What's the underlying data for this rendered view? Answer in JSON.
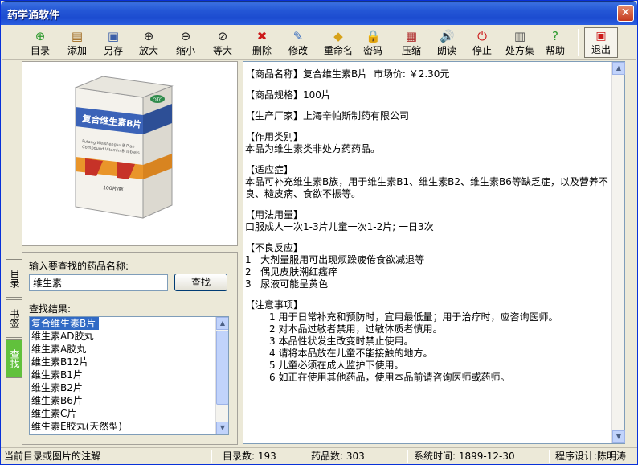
{
  "window": {
    "title": "药学通软件"
  },
  "toolbar": [
    {
      "label": "目录",
      "icon": "plus-circle-icon",
      "glyph": "⊕",
      "color": "#2e9a2e"
    },
    {
      "label": "添加",
      "icon": "add-folder-icon",
      "glyph": "▤",
      "color": "#a06a20"
    },
    {
      "label": "另存",
      "icon": "save-disk-icon",
      "glyph": "▣",
      "color": "#3b5fa8"
    },
    {
      "label": "放大",
      "icon": "zoom-in-icon",
      "glyph": "⊕",
      "color": "#222222"
    },
    {
      "label": "缩小",
      "icon": "zoom-out-icon",
      "glyph": "⊖",
      "color": "#222222"
    },
    {
      "label": "等大",
      "icon": "zoom-actual-icon",
      "glyph": "⊘",
      "color": "#222222"
    },
    {
      "label": "删除",
      "icon": "delete-icon",
      "glyph": "✖",
      "color": "#cc1a1a"
    },
    {
      "label": "修改",
      "icon": "edit-icon",
      "glyph": "✎",
      "color": "#3a6fc0"
    },
    {
      "label": "重命名",
      "icon": "rename-icon",
      "glyph": "◆",
      "color": "#d7a21a"
    },
    {
      "label": "密码",
      "icon": "lock-icon",
      "glyph": "🔒",
      "color": "#c49a16"
    },
    {
      "label": "压缩",
      "icon": "compress-icon",
      "glyph": "▦",
      "color": "#b03030"
    },
    {
      "label": "朗读",
      "icon": "speaker-icon",
      "glyph": "🔊",
      "color": "#2c4f9c"
    },
    {
      "label": "停止",
      "icon": "stop-power-icon",
      "glyph": "⏻",
      "color": "#cc1a1a"
    },
    {
      "label": "处方集",
      "icon": "document-icon",
      "glyph": "▥",
      "color": "#555555"
    },
    {
      "label": "帮助",
      "icon": "help-icon",
      "glyph": "?",
      "color": "#2e9a2e"
    }
  ],
  "exit_label": "退出",
  "tabs": [
    "目录",
    "书签",
    "查找"
  ],
  "search": {
    "prompt": "输入要查找的药品名称:",
    "value": "维生素",
    "button": "查找",
    "results_label": "查找结果:"
  },
  "results": [
    "复合维生素B片",
    "维生素AD胶丸",
    "维生素A胶丸",
    "维生素B12片",
    "维生素B1片",
    "维生素B2片",
    "维生素B6片",
    "维生素C片",
    "维生素E胶丸(天然型)"
  ],
  "product_image": {
    "box_title": "复合维生素B片",
    "box_sub1": "Fufang Weishengsu B Pian",
    "box_sub2": "Compound Vitamin B Tablets",
    "box_count": "100片/瓶",
    "box_logo": "OTC"
  },
  "details": [
    {
      "lines": [
        "【商品名称】复合维生素B片  市场价: ￥2.30元"
      ]
    },
    {
      "lines": [
        "【商品规格】100片"
      ]
    },
    {
      "lines": [
        "【生产厂家】上海辛帕斯制药有限公司"
      ]
    },
    {
      "lines": [
        "【作用类别】",
        "本品为维生素类非处方药药品。"
      ]
    },
    {
      "lines": [
        "【适应症】",
        "本品可补充维生素B族，用于维生素B1、维生素B2、维生素B6等缺乏症，以及营养不良、糙皮病、食欲不振等。"
      ]
    },
    {
      "lines": [
        "【用法用量】",
        "口服成人一次1-3片儿童一次1-2片; 一日3次"
      ]
    },
    {
      "lines": [
        "【不良反应】",
        "1   大剂量服用可出现烦躁疲倦食欲减退等",
        "2   偶见皮肤潮红瘙痒",
        "3   尿液可能呈黄色"
      ]
    },
    {
      "lines": [
        "【注意事项】"
      ],
      "indented": [
        "1 用于日常补充和预防时，宜用最低量；用于治疗时，应咨询医师。",
        "2 对本品过敏者禁用，过敏体质者慎用。",
        "3 本品性状发生改变时禁止使用。",
        "4 请将本品放在儿童不能接触的地方。",
        "5 儿童必须在成人监护下使用。",
        "6 如正在使用其他药品，使用本品前请咨询医师或药师。"
      ]
    }
  ],
  "status": {
    "hint": "当前目录或图片的注解",
    "catalog_count": "目录数: 193",
    "drug_count": "药品数: 303",
    "system_time": "系统时间: 1899-12-30",
    "designer": "程序设计:陈明涛"
  }
}
